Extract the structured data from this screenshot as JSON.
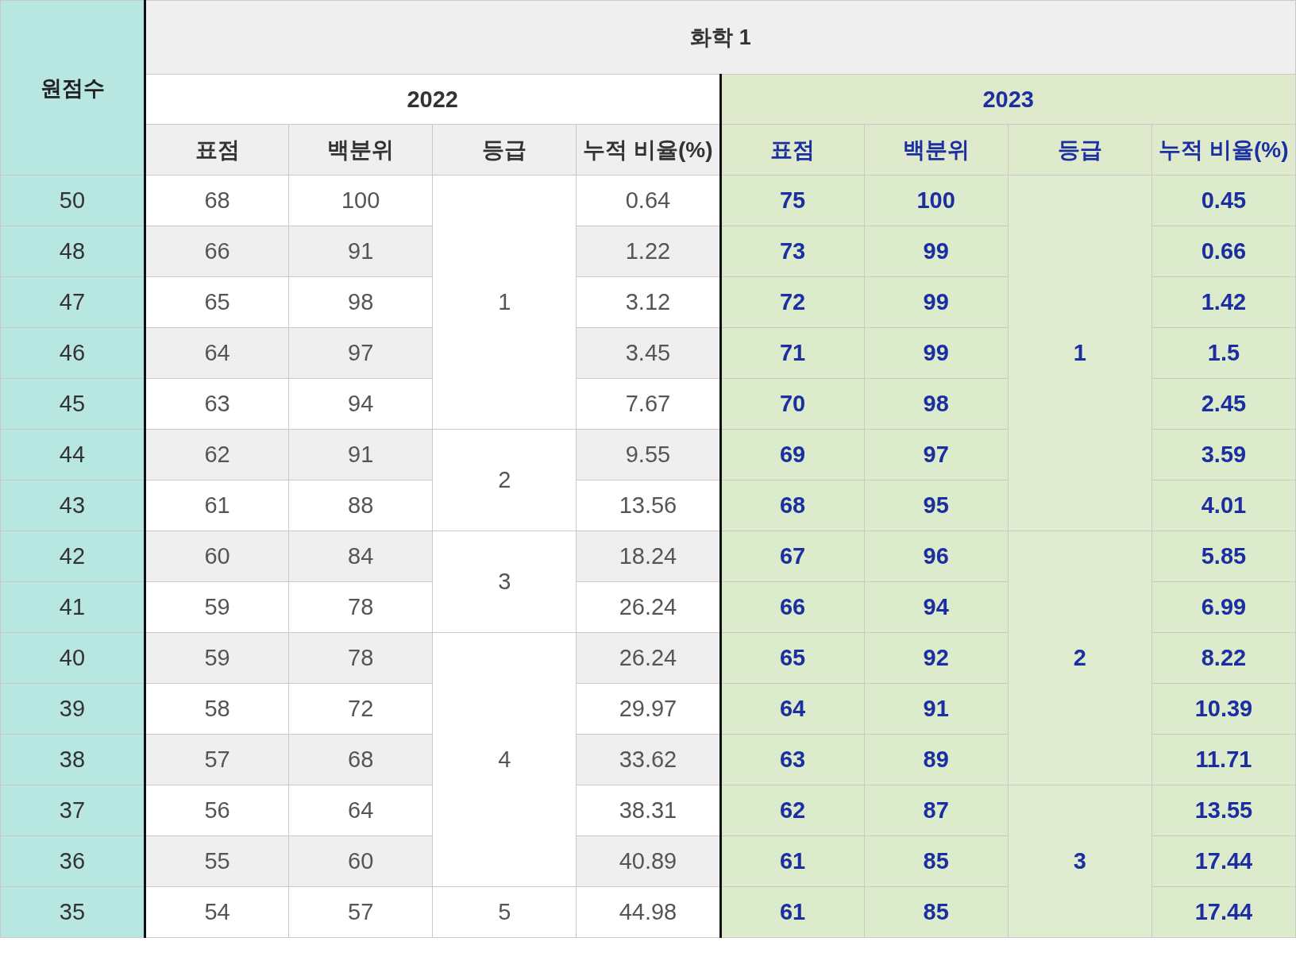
{
  "title": "화학 1",
  "row_header": "원점수",
  "years": [
    {
      "label": "2022",
      "kind": "previous",
      "columns": [
        "표점",
        "백분위",
        "등급",
        "누적 비율(%)"
      ]
    },
    {
      "label": "2023",
      "kind": "current",
      "columns": [
        "표점",
        "백분위",
        "등급",
        "누적 비율(%)"
      ]
    }
  ],
  "rows": [
    {
      "raw": "50",
      "years": [
        {
          "standard": "68",
          "percentile": "100",
          "grade": "1",
          "cumulative": "0.64"
        },
        {
          "standard": "75",
          "percentile": "100",
          "grade": "1",
          "cumulative": "0.45"
        }
      ]
    },
    {
      "raw": "48",
      "years": [
        {
          "standard": "66",
          "percentile": "91",
          "cumulative": "1.22"
        },
        {
          "standard": "73",
          "percentile": "99",
          "cumulative": "0.66"
        }
      ]
    },
    {
      "raw": "47",
      "years": [
        {
          "standard": "65",
          "percentile": "98",
          "cumulative": "3.12"
        },
        {
          "standard": "72",
          "percentile": "99",
          "cumulative": "1.42"
        }
      ]
    },
    {
      "raw": "46",
      "years": [
        {
          "standard": "64",
          "percentile": "97",
          "cumulative": "3.45"
        },
        {
          "standard": "71",
          "percentile": "99",
          "cumulative": "1.5"
        }
      ]
    },
    {
      "raw": "45",
      "years": [
        {
          "standard": "63",
          "percentile": "94",
          "cumulative": "7.67"
        },
        {
          "standard": "70",
          "percentile": "98",
          "cumulative": "2.45"
        }
      ]
    },
    {
      "raw": "44",
      "years": [
        {
          "standard": "62",
          "percentile": "91",
          "grade": "2",
          "cumulative": "9.55"
        },
        {
          "standard": "69",
          "percentile": "97",
          "cumulative": "3.59"
        }
      ]
    },
    {
      "raw": "43",
      "years": [
        {
          "standard": "61",
          "percentile": "88",
          "cumulative": "13.56"
        },
        {
          "standard": "68",
          "percentile": "95",
          "cumulative": "4.01"
        }
      ]
    },
    {
      "raw": "42",
      "years": [
        {
          "standard": "60",
          "percentile": "84",
          "grade": "3",
          "cumulative": "18.24"
        },
        {
          "standard": "67",
          "percentile": "96",
          "grade": "2",
          "cumulative": "5.85"
        }
      ]
    },
    {
      "raw": "41",
      "years": [
        {
          "standard": "59",
          "percentile": "78",
          "cumulative": "26.24"
        },
        {
          "standard": "66",
          "percentile": "94",
          "cumulative": "6.99"
        }
      ]
    },
    {
      "raw": "40",
      "years": [
        {
          "standard": "59",
          "percentile": "78",
          "grade": "4",
          "cumulative": "26.24"
        },
        {
          "standard": "65",
          "percentile": "92",
          "cumulative": "8.22"
        }
      ]
    },
    {
      "raw": "39",
      "years": [
        {
          "standard": "58",
          "percentile": "72",
          "cumulative": "29.97"
        },
        {
          "standard": "64",
          "percentile": "91",
          "cumulative": "10.39"
        }
      ]
    },
    {
      "raw": "38",
      "years": [
        {
          "standard": "57",
          "percentile": "68",
          "cumulative": "33.62"
        },
        {
          "standard": "63",
          "percentile": "89",
          "cumulative": "11.71"
        }
      ]
    },
    {
      "raw": "37",
      "years": [
        {
          "standard": "56",
          "percentile": "64",
          "cumulative": "38.31"
        },
        {
          "standard": "62",
          "percentile": "87",
          "grade": "3",
          "cumulative": "13.55"
        }
      ]
    },
    {
      "raw": "36",
      "years": [
        {
          "standard": "55",
          "percentile": "60",
          "cumulative": "40.89"
        },
        {
          "standard": "61",
          "percentile": "85",
          "cumulative": "17.44"
        }
      ]
    },
    {
      "raw": "35",
      "years": [
        {
          "standard": "54",
          "percentile": "57",
          "grade": "5",
          "cumulative": "44.98"
        },
        {
          "standard": "61",
          "percentile": "85",
          "cumulative": "17.44"
        }
      ]
    }
  ]
}
